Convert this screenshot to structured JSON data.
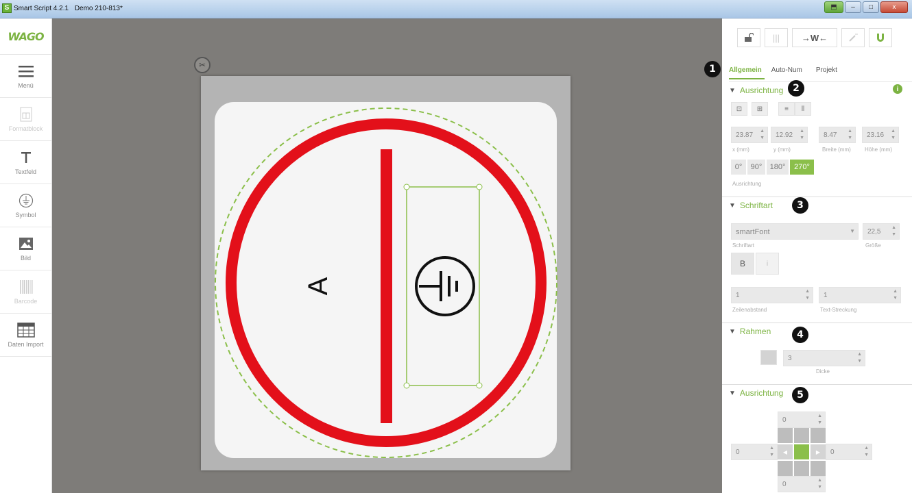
{
  "window": {
    "app_title": "Smart Script 4.2.1",
    "document": "Demo 210-813*",
    "buttons": {
      "minimize": "–",
      "maximize": "□",
      "close": "x"
    }
  },
  "left_toolbar": {
    "logo": "WAGO",
    "items": [
      {
        "label": "Menü",
        "icon": "hamburger-icon",
        "enabled": true
      },
      {
        "label": "Formatblock",
        "icon": "format-block-icon",
        "enabled": false
      },
      {
        "label": "Textfeld",
        "icon": "text-icon",
        "enabled": true
      },
      {
        "label": "Symbol",
        "icon": "ground-symbol-icon",
        "enabled": true
      },
      {
        "label": "Bild",
        "icon": "image-icon",
        "enabled": true
      },
      {
        "label": "Barcode",
        "icon": "barcode-icon",
        "enabled": false
      },
      {
        "label": "Daten Import",
        "icon": "table-icon",
        "enabled": true
      }
    ]
  },
  "canvas": {
    "label_text": "A",
    "symbol": "ground-symbol",
    "colors": {
      "ring": "#e3101a",
      "selection": "#8bbf4a",
      "label": "#f5f5f5",
      "page": "#b4b4b4"
    }
  },
  "top_tools": {
    "lock": "lock-open-icon",
    "columns": "|||",
    "wago_fit": "→W←",
    "wand": "wand-icon",
    "magnet": "magnet-icon"
  },
  "tabs": [
    {
      "label": "Allgemein",
      "active": true
    },
    {
      "label": "Auto-Num",
      "active": false
    },
    {
      "label": "Projekt",
      "active": false
    }
  ],
  "callouts": [
    "1",
    "2",
    "3",
    "4",
    "5"
  ],
  "section_ausrichtung": {
    "title": "Ausrichtung",
    "info": "i",
    "x_value": "23.87",
    "x_label": "x (mm)",
    "y_value": "12.92",
    "y_label": "y (mm)",
    "w_value": "8.47",
    "w_label": "Breite (mm)",
    "h_value": "23.16",
    "h_label": "Höhe (mm)",
    "rotations": [
      "0°",
      "90°",
      "180°",
      "270°"
    ],
    "active_rotation": "270°",
    "rotation_label": "Ausrichtung"
  },
  "section_schriftart": {
    "title": "Schriftart",
    "font_value": "smartFont",
    "font_label": "Schriftart",
    "size_value": "22,5",
    "size_label": "Größe",
    "bold": "B",
    "italic": "i",
    "line_spacing_value": "1",
    "line_spacing_label": "Zeilenabstand",
    "stretch_value": "1",
    "stretch_label": "Text-Streckung"
  },
  "section_rahmen": {
    "title": "Rahmen",
    "thickness_value": "3",
    "thickness_label": "Dicke"
  },
  "section_ausrichtung2": {
    "title": "Ausrichtung",
    "top": "0",
    "left": "0",
    "right": "0",
    "bottom": "0"
  }
}
